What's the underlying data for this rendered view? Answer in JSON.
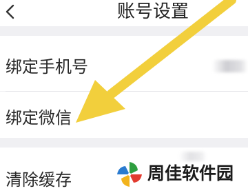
{
  "header": {
    "title": "账号设置",
    "back_icon": "chevron-left-icon"
  },
  "settings": {
    "bind_phone_label": "绑定手机号",
    "bind_wechat_label": "绑定微信",
    "clear_cache_label": "清除缓存"
  },
  "annotation": {
    "arrow_color": "#f2cf3c"
  },
  "watermark": {
    "text": "周佳软件园"
  }
}
